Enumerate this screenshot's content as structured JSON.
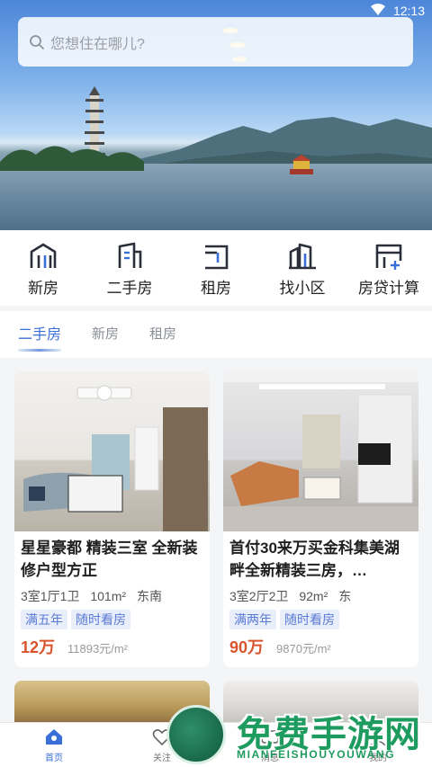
{
  "status_bar": {
    "time": "12:13"
  },
  "search": {
    "placeholder": "您想住在哪儿?"
  },
  "quick_nav": [
    {
      "label": "新房",
      "icon": "new-house-icon"
    },
    {
      "label": "二手房",
      "icon": "second-hand-house-icon"
    },
    {
      "label": "租房",
      "icon": "rent-icon"
    },
    {
      "label": "找小区",
      "icon": "community-icon"
    },
    {
      "label": "房贷计算",
      "icon": "mortgage-calculator-icon"
    }
  ],
  "tabs": [
    {
      "label": "二手房",
      "active": true
    },
    {
      "label": "新房",
      "active": false
    },
    {
      "label": "租房",
      "active": false
    }
  ],
  "listings": [
    {
      "title": "星星豪都 精装三室 全新装修户型方正",
      "layout": "3室1厅1卫",
      "area": "101m²",
      "orientation": "东南",
      "tags": [
        "满五年",
        "随时看房"
      ],
      "total_price": "12万",
      "unit_price": "11893元/m²"
    },
    {
      "title": "首付30来万买金科集美湖畔全新精装三房，…",
      "layout": "3室2厅2卫",
      "area": "92m²",
      "orientation": "东",
      "tags": [
        "满两年",
        "随时看房"
      ],
      "total_price": "90万",
      "unit_price": "9870元/m²"
    }
  ],
  "bottom_nav": [
    {
      "label": "首页",
      "icon": "home-icon",
      "active": true
    },
    {
      "label": "关注",
      "icon": "heart-icon",
      "active": false
    },
    {
      "label": "消息",
      "icon": "message-icon",
      "active": false
    },
    {
      "label": "我的",
      "icon": "profile-icon",
      "active": false
    }
  ],
  "watermark": {
    "title": "免费手游网",
    "subtitle": "MIANFEISHOUYOUWANG"
  },
  "colors": {
    "accent": "#3a6fd8",
    "price": "#d9542c",
    "tag_bg": "#e9eefb",
    "tag_text": "#5a7bd5"
  }
}
